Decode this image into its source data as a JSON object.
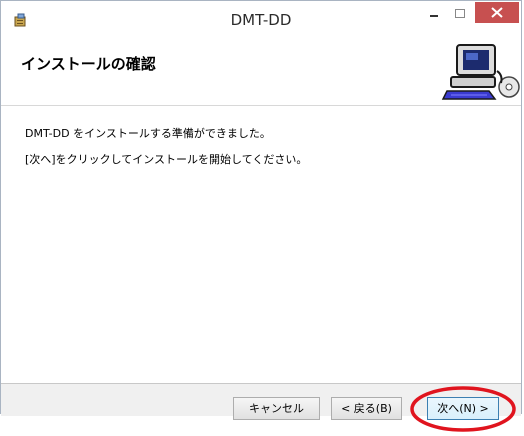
{
  "window": {
    "title": "DMT-DD"
  },
  "header": {
    "title": "インストールの確認"
  },
  "content": {
    "line1": "DMT-DD をインストールする準備ができました。",
    "line2": "[次へ]をクリックしてインストールを開始してください。"
  },
  "footer": {
    "cancel_label": "キャンセル",
    "back_label": "< 戻る(B)",
    "next_label": "次へ(N) >"
  },
  "colors": {
    "close_button": "#c75050",
    "annotation_circle": "#e0141e"
  }
}
